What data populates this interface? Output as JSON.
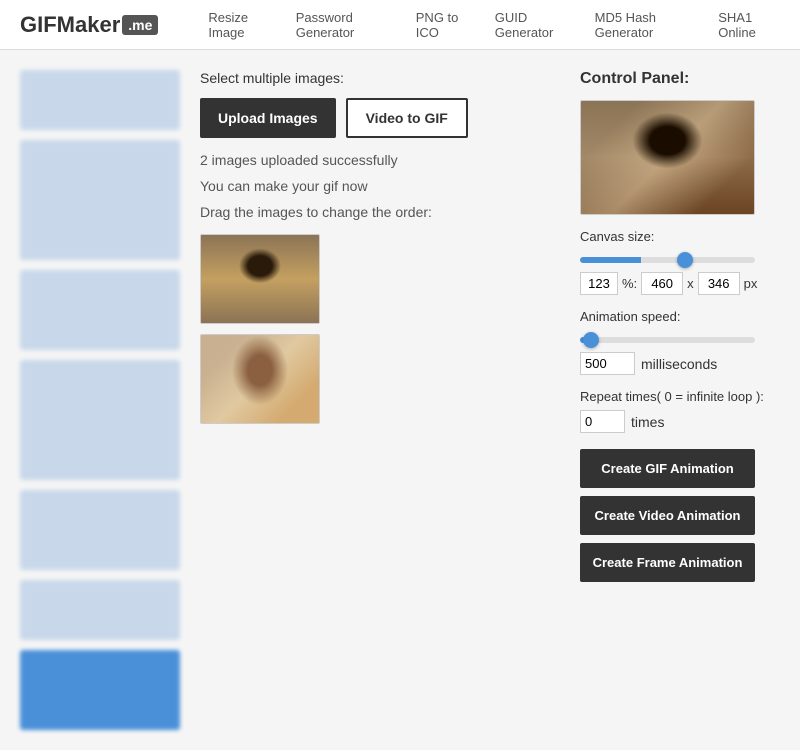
{
  "header": {
    "logo_text": "GIFMaker",
    "logo_badge": ".me",
    "nav_items": [
      {
        "label": "Resize Image",
        "href": "#"
      },
      {
        "label": "Password Generator",
        "href": "#"
      },
      {
        "label": "PNG to ICO",
        "href": "#"
      },
      {
        "label": "GUID Generator",
        "href": "#"
      },
      {
        "label": "MD5 Hash Generator",
        "href": "#"
      },
      {
        "label": "SHA1 Online",
        "href": "#"
      }
    ]
  },
  "main": {
    "select_label": "Select multiple images:",
    "upload_button": "Upload Images",
    "video_button": "Video to GIF",
    "upload_success": "2 images uploaded successfully",
    "make_gif_text": "You can make your gif now",
    "drag_text": "Drag the images to change the order:"
  },
  "control_panel": {
    "title": "Control Panel:",
    "canvas_size_label": "Canvas size:",
    "percent_value": "123",
    "percent_symbol": "%:",
    "width_value": "460",
    "x_separator": "x",
    "height_value": "346",
    "px_label": "px",
    "animation_speed_label": "Animation speed:",
    "speed_value": "500",
    "milliseconds_label": "milliseconds",
    "repeat_label": "Repeat times( 0 = infinite loop ):",
    "repeat_value": "0",
    "times_label": "times",
    "btn_gif": "Create GIF Animation",
    "btn_video": "Create Video Animation",
    "btn_frame": "Create Frame Animation"
  }
}
